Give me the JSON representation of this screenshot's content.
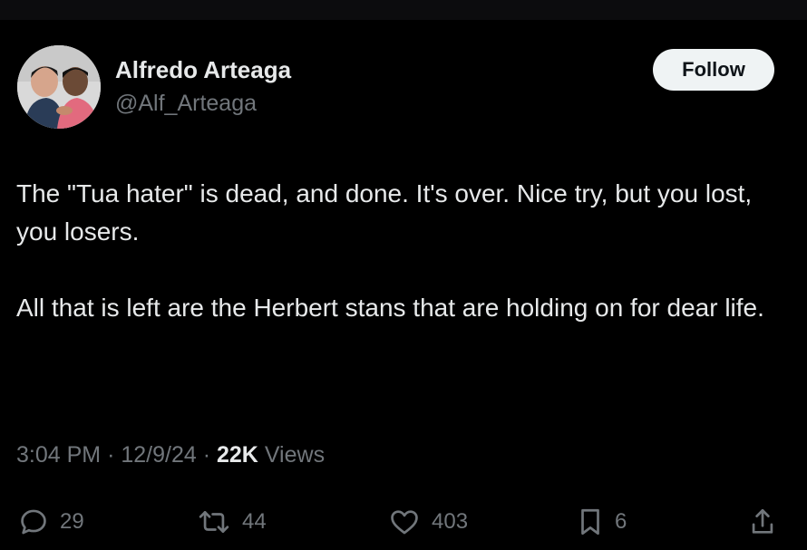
{
  "author": {
    "name": "Alfredo Arteaga",
    "handle": "@Alf_Arteaga"
  },
  "follow_button": {
    "label": "Follow"
  },
  "tweet": {
    "paragraphs": [
      "The \"Tua hater\" is dead, and done.  It's over.  Nice try, but you lost, you losers.",
      "All that is left are the Herbert stans that are holding on for dear life."
    ]
  },
  "meta": {
    "time": "3:04 PM",
    "separator": "·",
    "date": "12/9/24",
    "views_count": "22K",
    "views_label": "Views"
  },
  "actions": {
    "replies": {
      "icon": "reply-icon",
      "count": "29"
    },
    "reposts": {
      "icon": "repost-icon",
      "count": "44"
    },
    "likes": {
      "icon": "heart-icon",
      "count": "403"
    },
    "bookmarks": {
      "icon": "bookmark-icon",
      "count": "6"
    },
    "share": {
      "icon": "share-icon"
    }
  },
  "colors": {
    "background": "#000000",
    "text": "#e7e9ea",
    "secondary_text": "#71767b",
    "follow_button_bg": "#eff3f4",
    "follow_button_text": "#0f1419"
  }
}
